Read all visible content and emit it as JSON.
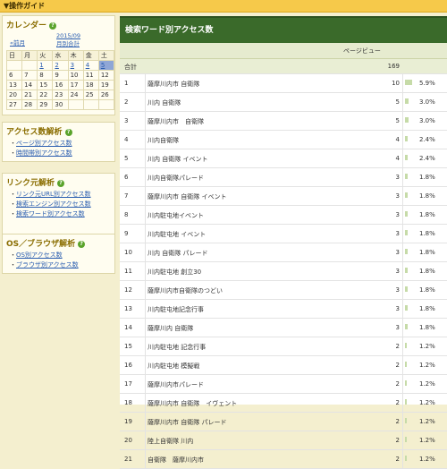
{
  "topbar": {
    "title": "▼操作ガイド"
  },
  "calendar": {
    "title": "カレンダー",
    "prev": "«前月",
    "month": "2015/09",
    "monthly_total": "月別合計",
    "weekdays": [
      "日",
      "月",
      "火",
      "水",
      "木",
      "金",
      "土"
    ],
    "weeks": [
      [
        "",
        "",
        "1",
        "2",
        "3",
        "4",
        "5"
      ],
      [
        "6",
        "7",
        "8",
        "9",
        "10",
        "11",
        "12"
      ],
      [
        "13",
        "14",
        "15",
        "16",
        "17",
        "18",
        "19"
      ],
      [
        "20",
        "21",
        "22",
        "23",
        "24",
        "25",
        "26"
      ],
      [
        "27",
        "28",
        "29",
        "30",
        "",
        "",
        ""
      ]
    ],
    "linked_days": [
      "1",
      "2",
      "3",
      "4",
      "5"
    ],
    "today": "5"
  },
  "access_analysis": {
    "title": "アクセス数解析",
    "items": [
      "ページ別アクセス数",
      "時間帯別アクセス数"
    ]
  },
  "referrer_analysis": {
    "title": "リンク元解析",
    "items": [
      "リンク元URL別アクセス数",
      "検索エンジン別アクセス数",
      "検索ワード別アクセス数"
    ]
  },
  "os_analysis": {
    "title": "OS／ブラウザ解析",
    "items": [
      "OS別アクセス数",
      "ブラウザ別アクセス数"
    ]
  },
  "main": {
    "title": "検索ワード別アクセス数",
    "column": "ページビュー",
    "total_label": "合計",
    "total_value": "169",
    "rows": [
      {
        "n": "1",
        "word": "薩摩川内市 自衛隊",
        "count": "10",
        "pct": "5.9%",
        "fill": 5.9
      },
      {
        "n": "2",
        "word": "川内 自衛隊",
        "count": "5",
        "pct": "3.0%",
        "fill": 3.0
      },
      {
        "n": "3",
        "word": "薩摩川内市　自衛隊",
        "count": "5",
        "pct": "3.0%",
        "fill": 3.0
      },
      {
        "n": "4",
        "word": "川内自衛隊",
        "count": "4",
        "pct": "2.4%",
        "fill": 2.4
      },
      {
        "n": "5",
        "word": "川内 自衛隊 イベント",
        "count": "4",
        "pct": "2.4%",
        "fill": 2.4
      },
      {
        "n": "6",
        "word": "川内自衛隊パレード",
        "count": "3",
        "pct": "1.8%",
        "fill": 1.8
      },
      {
        "n": "7",
        "word": "薩摩川内市 自衛隊 イベント",
        "count": "3",
        "pct": "1.8%",
        "fill": 1.8
      },
      {
        "n": "8",
        "word": "川内駐屯地イベント",
        "count": "3",
        "pct": "1.8%",
        "fill": 1.8
      },
      {
        "n": "9",
        "word": "川内駐屯地 イベント",
        "count": "3",
        "pct": "1.8%",
        "fill": 1.8
      },
      {
        "n": "10",
        "word": "川内 自衛隊 パレード",
        "count": "3",
        "pct": "1.8%",
        "fill": 1.8
      },
      {
        "n": "11",
        "word": "川内駐屯地 創立30",
        "count": "3",
        "pct": "1.8%",
        "fill": 1.8
      },
      {
        "n": "12",
        "word": "薩摩川内市自衛隊のつどい",
        "count": "3",
        "pct": "1.8%",
        "fill": 1.8
      },
      {
        "n": "13",
        "word": "川内駐屯地記念行事",
        "count": "3",
        "pct": "1.8%",
        "fill": 1.8
      },
      {
        "n": "14",
        "word": "薩摩川内 自衛隊",
        "count": "3",
        "pct": "1.8%",
        "fill": 1.8
      },
      {
        "n": "15",
        "word": "川内駐屯地 記念行事",
        "count": "2",
        "pct": "1.2%",
        "fill": 1.2
      },
      {
        "n": "16",
        "word": "川内駐屯地 模擬戦",
        "count": "2",
        "pct": "1.2%",
        "fill": 1.2
      },
      {
        "n": "17",
        "word": "薩摩川内市パレード",
        "count": "2",
        "pct": "1.2%",
        "fill": 1.2
      },
      {
        "n": "18",
        "word": "薩摩川内市 自衛隊　イヴェント",
        "count": "2",
        "pct": "1.2%",
        "fill": 1.2
      },
      {
        "n": "19",
        "word": "薩摩川内市 自衛隊 パレード",
        "count": "2",
        "pct": "1.2%",
        "fill": 1.2
      },
      {
        "n": "20",
        "word": "陸上自衛隊 川内",
        "count": "2",
        "pct": "1.2%",
        "fill": 1.2
      },
      {
        "n": "21",
        "word": "自衛隊　薩摩川内市",
        "count": "2",
        "pct": "1.2%",
        "fill": 1.2
      }
    ]
  },
  "colors": {
    "header_green": "#3a6a2a",
    "topbar_yellow": "#f6c94a",
    "link_blue": "#2a5db0",
    "bar_green": "#c6dba8"
  }
}
